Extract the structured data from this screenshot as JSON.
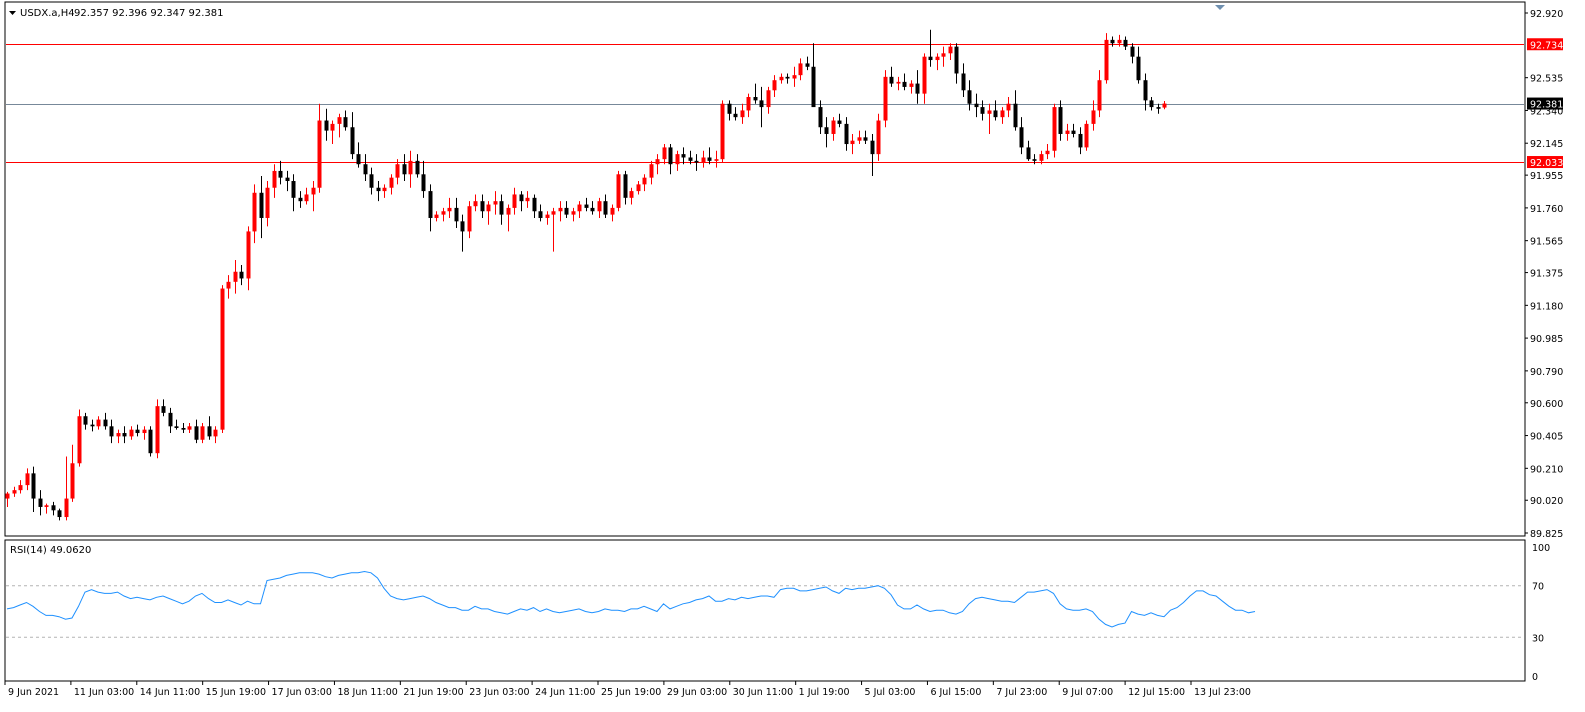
{
  "chart_header": {
    "dropdown_icon": "triangle-down-icon",
    "symbol": "USDX.a,H4",
    "ohlc": "92.357 92.396 92.347 92.381"
  },
  "rsi_header": "RSI(14) 49.0620",
  "colors": {
    "bull": "#ff0000",
    "bear": "#000000",
    "level_line": "#ff0000",
    "bid_line": "#778899",
    "rsi_line": "#1e90ff",
    "frame": "#000000",
    "rsi_level": "#b4b4b4"
  },
  "chart_data": [
    {
      "type": "candlestick",
      "title": "USDX.a,H4",
      "price_axis_ticks": [
        "92.920",
        "92.734",
        "92.535",
        "92.381",
        "92.340",
        "92.145",
        "92.033",
        "91.955",
        "91.760",
        "91.565",
        "91.375",
        "91.180",
        "90.985",
        "90.790",
        "90.600",
        "90.405",
        "90.210",
        "90.020",
        "89.825"
      ],
      "time_axis_labels": [
        "9 Jun 2021",
        "11 Jun 03:00",
        "14 Jun 11:00",
        "15 Jun 19:00",
        "17 Jun 03:00",
        "18 Jun 11:00",
        "21 Jun 19:00",
        "23 Jun 03:00",
        "24 Jun 11:00",
        "25 Jun 19:00",
        "29 Jun 03:00",
        "30 Jun 11:00",
        "1 Jul 19:00",
        "5 Jul 03:00",
        "6 Jul 15:00",
        "7 Jul 23:00",
        "9 Jul 07:00",
        "12 Jul 15:00",
        "13 Jul 23:00"
      ],
      "ylim": [
        89.825,
        92.92
      ],
      "horizontal_levels": [
        {
          "price": 92.734,
          "label": "92.734",
          "kind": "resistance"
        },
        {
          "price": 92.381,
          "label": "92.381",
          "kind": "bid"
        },
        {
          "price": 92.033,
          "label": "92.033",
          "kind": "support"
        }
      ],
      "ohlc": [
        [
          90.03,
          90.07,
          89.98,
          90.06
        ],
        [
          90.06,
          90.1,
          90.04,
          90.08
        ],
        [
          90.08,
          90.14,
          90.06,
          90.11
        ],
        [
          90.11,
          90.21,
          90.08,
          90.18
        ],
        [
          90.18,
          90.22,
          89.95,
          90.03
        ],
        [
          90.03,
          90.08,
          89.93,
          89.98
        ],
        [
          89.98,
          90.0,
          89.94,
          89.99
        ],
        [
          89.99,
          90.01,
          89.93,
          89.96
        ],
        [
          89.96,
          89.97,
          89.9,
          89.92
        ],
        [
          89.92,
          90.28,
          89.9,
          90.03
        ],
        [
          90.03,
          90.35,
          90.01,
          90.24
        ],
        [
          90.24,
          90.56,
          90.22,
          90.52
        ],
        [
          90.52,
          90.54,
          90.44,
          90.47
        ],
        [
          90.47,
          90.5,
          90.43,
          90.46
        ],
        [
          90.46,
          90.52,
          90.44,
          90.5
        ],
        [
          90.5,
          90.54,
          90.44,
          90.46
        ],
        [
          90.46,
          90.5,
          90.36,
          90.4
        ],
        [
          90.4,
          90.44,
          90.36,
          90.42
        ],
        [
          90.42,
          90.46,
          90.36,
          90.4
        ],
        [
          90.4,
          90.46,
          90.38,
          90.44
        ],
        [
          90.44,
          90.47,
          90.4,
          90.42
        ],
        [
          90.42,
          90.46,
          90.38,
          90.44
        ],
        [
          90.44,
          90.46,
          90.28,
          90.3
        ],
        [
          90.3,
          90.62,
          90.27,
          90.58
        ],
        [
          90.58,
          90.62,
          90.52,
          90.54
        ],
        [
          90.54,
          90.57,
          90.42,
          90.46
        ],
        [
          90.46,
          90.5,
          90.44,
          90.45
        ],
        [
          90.45,
          90.48,
          90.42,
          90.44
        ],
        [
          90.44,
          90.48,
          90.42,
          90.46
        ],
        [
          90.46,
          90.5,
          90.36,
          90.38
        ],
        [
          90.38,
          90.48,
          90.36,
          90.46
        ],
        [
          90.46,
          90.52,
          90.38,
          90.4
        ],
        [
          90.4,
          90.46,
          90.36,
          90.44
        ],
        [
          90.44,
          91.3,
          90.42,
          91.28
        ],
        [
          91.28,
          91.36,
          91.22,
          91.32
        ],
        [
          91.32,
          91.45,
          91.25,
          91.38
        ],
        [
          91.38,
          91.42,
          91.3,
          91.34
        ],
        [
          91.34,
          91.65,
          91.27,
          91.62
        ],
        [
          91.62,
          91.9,
          91.55,
          91.85
        ],
        [
          91.85,
          91.95,
          91.58,
          91.7
        ],
        [
          91.7,
          91.92,
          91.65,
          91.88
        ],
        [
          91.88,
          92.02,
          91.82,
          91.98
        ],
        [
          91.98,
          92.04,
          91.9,
          91.94
        ],
        [
          91.94,
          91.98,
          91.86,
          91.92
        ],
        [
          91.92,
          91.96,
          91.74,
          91.82
        ],
        [
          91.82,
          91.86,
          91.76,
          91.8
        ],
        [
          91.8,
          91.88,
          91.78,
          91.84
        ],
        [
          91.84,
          91.92,
          91.74,
          91.88
        ],
        [
          91.88,
          92.38,
          91.85,
          92.28
        ],
        [
          92.28,
          92.35,
          92.16,
          92.22
        ],
        [
          92.22,
          92.28,
          92.14,
          92.26
        ],
        [
          92.26,
          92.32,
          92.18,
          92.3
        ],
        [
          92.3,
          92.34,
          92.22,
          92.24
        ],
        [
          92.24,
          92.33,
          92.05,
          92.08
        ],
        [
          92.08,
          92.15,
          92.0,
          92.02
        ],
        [
          92.02,
          92.08,
          91.92,
          91.96
        ],
        [
          91.96,
          92.0,
          91.84,
          91.88
        ],
        [
          91.88,
          91.92,
          91.8,
          91.86
        ],
        [
          91.86,
          91.9,
          91.82,
          91.88
        ],
        [
          91.88,
          91.96,
          91.84,
          91.94
        ],
        [
          91.94,
          92.05,
          91.9,
          92.02
        ],
        [
          92.02,
          92.08,
          91.92,
          91.96
        ],
        [
          91.96,
          92.1,
          91.88,
          92.04
        ],
        [
          92.04,
          92.08,
          91.94,
          91.96
        ],
        [
          91.96,
          92.04,
          91.82,
          91.86
        ],
        [
          91.86,
          91.9,
          91.62,
          91.7
        ],
        [
          91.7,
          91.74,
          91.68,
          91.72
        ],
        [
          91.72,
          91.76,
          91.68,
          91.74
        ],
        [
          91.74,
          91.82,
          91.7,
          91.76
        ],
        [
          91.76,
          91.82,
          91.64,
          91.68
        ],
        [
          91.68,
          91.72,
          91.5,
          91.62
        ],
        [
          91.62,
          91.8,
          91.58,
          91.77
        ],
        [
          91.77,
          91.84,
          91.74,
          91.8
        ],
        [
          91.8,
          91.84,
          91.7,
          91.74
        ],
        [
          91.74,
          91.8,
          91.66,
          91.78
        ],
        [
          91.78,
          91.86,
          91.72,
          91.8
        ],
        [
          91.8,
          91.84,
          91.66,
          91.72
        ],
        [
          91.72,
          91.78,
          91.62,
          91.76
        ],
        [
          91.76,
          91.88,
          91.72,
          91.84
        ],
        [
          91.84,
          91.86,
          91.74,
          91.8
        ],
        [
          91.8,
          91.86,
          91.76,
          91.82
        ],
        [
          91.82,
          91.84,
          91.7,
          91.74
        ],
        [
          91.74,
          91.78,
          91.68,
          91.7
        ],
        [
          91.7,
          91.74,
          91.66,
          91.72
        ],
        [
          91.72,
          91.76,
          91.5,
          91.74
        ],
        [
          91.74,
          91.8,
          91.68,
          91.76
        ],
        [
          91.76,
          91.8,
          91.7,
          91.72
        ],
        [
          91.72,
          91.76,
          91.68,
          91.74
        ],
        [
          91.74,
          91.8,
          91.7,
          91.78
        ],
        [
          91.78,
          91.82,
          91.74,
          91.76
        ],
        [
          91.76,
          91.8,
          91.72,
          91.74
        ],
        [
          91.74,
          91.82,
          91.7,
          91.8
        ],
        [
          91.8,
          91.84,
          91.7,
          91.72
        ],
        [
          91.72,
          91.78,
          91.68,
          91.76
        ],
        [
          91.76,
          91.98,
          91.74,
          91.96
        ],
        [
          91.96,
          91.98,
          91.78,
          91.82
        ],
        [
          91.82,
          91.88,
          91.78,
          91.86
        ],
        [
          91.86,
          91.92,
          91.84,
          91.9
        ],
        [
          91.9,
          91.96,
          91.86,
          91.94
        ],
        [
          91.94,
          92.04,
          91.9,
          92.02
        ],
        [
          92.02,
          92.08,
          91.96,
          92.05
        ],
        [
          92.05,
          92.14,
          92.02,
          92.12
        ],
        [
          92.12,
          92.14,
          91.96,
          92.02
        ],
        [
          92.02,
          92.1,
          91.98,
          92.08
        ],
        [
          92.08,
          92.12,
          92.02,
          92.06
        ],
        [
          92.06,
          92.1,
          92.02,
          92.04
        ],
        [
          92.04,
          92.08,
          91.98,
          92.03
        ],
        [
          92.03,
          92.1,
          92.0,
          92.06
        ],
        [
          92.06,
          92.12,
          92.02,
          92.04
        ],
        [
          92.04,
          92.1,
          92.0,
          92.05
        ],
        [
          92.05,
          92.4,
          92.03,
          92.38
        ],
        [
          92.38,
          92.4,
          92.28,
          92.32
        ],
        [
          92.32,
          92.36,
          92.28,
          92.3
        ],
        [
          92.3,
          92.38,
          92.26,
          92.34
        ],
        [
          92.34,
          92.44,
          92.3,
          92.42
        ],
        [
          92.42,
          92.5,
          92.38,
          92.4
        ],
        [
          92.4,
          92.48,
          92.24,
          92.36
        ],
        [
          92.36,
          92.48,
          92.32,
          92.46
        ],
        [
          92.46,
          92.55,
          92.42,
          92.52
        ],
        [
          92.52,
          92.56,
          92.5,
          92.54
        ],
        [
          92.54,
          92.56,
          92.5,
          92.53
        ],
        [
          92.53,
          92.6,
          92.48,
          92.55
        ],
        [
          92.55,
          92.65,
          92.52,
          92.62
        ],
        [
          92.62,
          92.66,
          92.58,
          92.6
        ],
        [
          92.6,
          92.74,
          92.48,
          92.36
        ],
        [
          92.36,
          92.4,
          92.2,
          92.24
        ],
        [
          92.24,
          92.3,
          92.12,
          92.2
        ],
        [
          92.2,
          92.3,
          92.16,
          92.28
        ],
        [
          92.28,
          92.32,
          92.24,
          92.26
        ],
        [
          92.26,
          92.3,
          92.1,
          92.14
        ],
        [
          92.14,
          92.2,
          92.08,
          92.16
        ],
        [
          92.16,
          92.22,
          92.14,
          92.18
        ],
        [
          92.18,
          92.22,
          92.14,
          92.16
        ],
        [
          92.16,
          92.2,
          91.95,
          92.08
        ],
        [
          92.08,
          92.32,
          92.04,
          92.28
        ],
        [
          92.28,
          92.58,
          92.24,
          92.54
        ],
        [
          92.54,
          92.6,
          92.48,
          92.5
        ],
        [
          92.5,
          92.54,
          92.46,
          92.51
        ],
        [
          92.51,
          92.56,
          92.46,
          92.48
        ],
        [
          92.48,
          92.52,
          92.44,
          92.5
        ],
        [
          92.5,
          92.58,
          92.38,
          92.44
        ],
        [
          92.44,
          92.68,
          92.38,
          92.66
        ],
        [
          92.66,
          92.82,
          92.6,
          92.64
        ],
        [
          92.64,
          92.68,
          92.58,
          92.66
        ],
        [
          92.66,
          92.72,
          92.6,
          92.68
        ],
        [
          92.68,
          92.74,
          92.64,
          92.72
        ],
        [
          92.72,
          92.74,
          92.5,
          92.56
        ],
        [
          92.56,
          92.62,
          92.42,
          92.46
        ],
        [
          92.46,
          92.52,
          92.34,
          92.38
        ],
        [
          92.38,
          92.44,
          92.3,
          92.36
        ],
        [
          92.36,
          92.4,
          92.28,
          92.32
        ],
        [
          92.32,
          92.38,
          92.2,
          92.34
        ],
        [
          92.34,
          92.4,
          92.28,
          92.3
        ],
        [
          92.3,
          92.36,
          92.26,
          92.34
        ],
        [
          92.34,
          92.42,
          92.3,
          92.38
        ],
        [
          92.38,
          92.46,
          92.22,
          92.24
        ],
        [
          92.24,
          92.3,
          92.08,
          92.12
        ],
        [
          92.12,
          92.16,
          92.04,
          92.05
        ],
        [
          92.05,
          92.08,
          92.02,
          92.04
        ],
        [
          92.04,
          92.1,
          92.02,
          92.08
        ],
        [
          92.08,
          92.14,
          92.05,
          92.1
        ],
        [
          92.1,
          92.38,
          92.06,
          92.36
        ],
        [
          92.36,
          92.4,
          92.16,
          92.2
        ],
        [
          92.2,
          92.26,
          92.16,
          92.22
        ],
        [
          92.22,
          92.26,
          92.18,
          92.2
        ],
        [
          92.2,
          92.24,
          92.08,
          92.12
        ],
        [
          92.12,
          92.28,
          92.1,
          92.26
        ],
        [
          92.26,
          92.4,
          92.22,
          92.34
        ],
        [
          92.34,
          92.58,
          92.3,
          92.52
        ],
        [
          92.52,
          92.8,
          92.5,
          92.76
        ],
        [
          92.76,
          92.78,
          92.72,
          92.74
        ],
        [
          92.74,
          92.79,
          92.72,
          92.76
        ],
        [
          92.76,
          92.78,
          92.7,
          92.72
        ],
        [
          92.72,
          92.74,
          92.62,
          92.66
        ],
        [
          92.66,
          92.72,
          92.5,
          92.52
        ],
        [
          92.52,
          92.56,
          92.34,
          92.4
        ],
        [
          92.4,
          92.42,
          92.34,
          92.36
        ],
        [
          92.36,
          92.38,
          92.32,
          92.35
        ],
        [
          92.357,
          92.396,
          92.347,
          92.381
        ]
      ]
    },
    {
      "type": "line",
      "title": "RSI(14) 49.0620",
      "ylim": [
        0,
        100
      ],
      "y_ticks": [
        "100",
        "70",
        "30",
        "0"
      ],
      "levels": [
        70,
        30
      ],
      "values": [
        52,
        53,
        55,
        57,
        54,
        50,
        47,
        47,
        46,
        44,
        45,
        54,
        65,
        67,
        65,
        64,
        64,
        65,
        62,
        60,
        61,
        60,
        59,
        61,
        62,
        60,
        58,
        56,
        58,
        62,
        64,
        60,
        57,
        57,
        59,
        57,
        55,
        58,
        56,
        56,
        74,
        75,
        76,
        78,
        79,
        80,
        80,
        80,
        79,
        77,
        76,
        78,
        79,
        80,
        80,
        81,
        80,
        76,
        68,
        62,
        60,
        59,
        60,
        61,
        62,
        60,
        57,
        55,
        53,
        53,
        51,
        51,
        54,
        52,
        52,
        50,
        49,
        48,
        50,
        52,
        51,
        53,
        50,
        52,
        50,
        49,
        50,
        51,
        52,
        50,
        49,
        50,
        52,
        51,
        51,
        50,
        52,
        52,
        54,
        52,
        50,
        56,
        52,
        54,
        56,
        57,
        59,
        60,
        62,
        58,
        58,
        60,
        59,
        61,
        60,
        61,
        62,
        62,
        61,
        67,
        68,
        68,
        66,
        66,
        67,
        68,
        69,
        66,
        64,
        68,
        67,
        68,
        68,
        69,
        70,
        68,
        63,
        55,
        52,
        52,
        55,
        52,
        50,
        51,
        51,
        49,
        48,
        50,
        56,
        60,
        61,
        60,
        59,
        58,
        58,
        57,
        61,
        65,
        65,
        66,
        67,
        64,
        56,
        52,
        51,
        51,
        52,
        50,
        44,
        40,
        38,
        40,
        41,
        50,
        48,
        47,
        49,
        47,
        46,
        51,
        53,
        57,
        62,
        66,
        66,
        63,
        62,
        58,
        54,
        51,
        51,
        49,
        50
      ]
    }
  ]
}
